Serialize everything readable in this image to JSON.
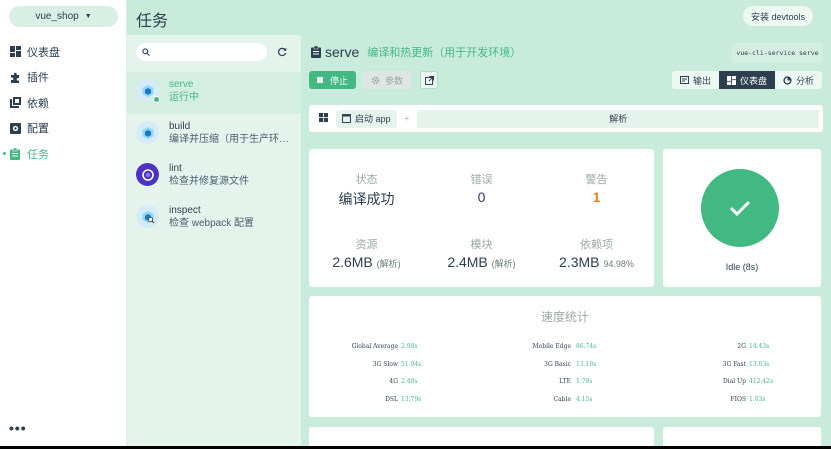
{
  "nav": {
    "project": "vue_shop",
    "items": [
      {
        "label": "仪表盘",
        "icon": "dashboard-icon"
      },
      {
        "label": "插件",
        "icon": "puzzle-icon"
      },
      {
        "label": "依赖",
        "icon": "library-icon"
      },
      {
        "label": "配置",
        "icon": "settings-icon"
      },
      {
        "label": "任务",
        "icon": "clipboard-icon",
        "active": true
      }
    ],
    "more": "•••"
  },
  "header": {
    "title": "任务",
    "devtools": "安装 devtools"
  },
  "search": {
    "placeholder": "",
    "value": ""
  },
  "tasks": [
    {
      "name": "serve",
      "desc": "运行中",
      "active": true
    },
    {
      "name": "build",
      "desc": "编译并压缩（用于生产环境）"
    },
    {
      "name": "lint",
      "desc": "检查并修复源文件"
    },
    {
      "name": "inspect",
      "desc": "检查 webpack 配置"
    }
  ],
  "task_detail": {
    "name": "serve",
    "description": "编译和热更新（用于开发环境）",
    "command": "vue-cli-service serve",
    "stop_label": "停止",
    "params_label": "参数",
    "tabs": {
      "output": "输出",
      "dashboard": "仪表盘",
      "analyze": "分析"
    },
    "toolbar": {
      "start_app": "启动 app",
      "plus": "+",
      "analyze": "解析"
    }
  },
  "stats": {
    "status_label": "状态",
    "status_value": "编译成功",
    "errors_label": "错误",
    "errors_value": "0",
    "warnings_label": "警告",
    "warnings_value": "1",
    "assets_label": "资源",
    "assets_value": "2.6MB",
    "assets_note": "(解析)",
    "modules_label": "模块",
    "modules_value": "2.4MB",
    "modules_note": "(解析)",
    "deps_label": "依赖项",
    "deps_value": "2.3MB",
    "deps_note": "94.98%"
  },
  "idle": {
    "label": "Idle (8s)"
  },
  "speed": {
    "title": "速度统计",
    "rows": [
      [
        {
          "label": "Global Average",
          "value": "2.98s"
        },
        {
          "label": "Mobile Edge",
          "value": "86.74s"
        },
        {
          "label": "2G",
          "value": "14.43s"
        }
      ],
      [
        {
          "label": "3G Slow",
          "value": "51.94s"
        },
        {
          "label": "3G Basic",
          "value": "13.18s"
        },
        {
          "label": "3G Fast",
          "value": "13.03s"
        }
      ],
      [
        {
          "label": "4G",
          "value": "2.48s"
        },
        {
          "label": "LTE",
          "value": "1.79s"
        },
        {
          "label": "Dial Up",
          "value": "412.42s"
        }
      ],
      [
        {
          "label": "DSL",
          "value": "13.79s"
        },
        {
          "label": "Cable",
          "value": "4.15s"
        },
        {
          "label": "FIOS",
          "value": "1.03s"
        }
      ]
    ]
  },
  "colors": {
    "accent": "#42b983",
    "dark": "#2c3e50",
    "warning": "#e08a1e",
    "panel": "#c9ebdb"
  }
}
